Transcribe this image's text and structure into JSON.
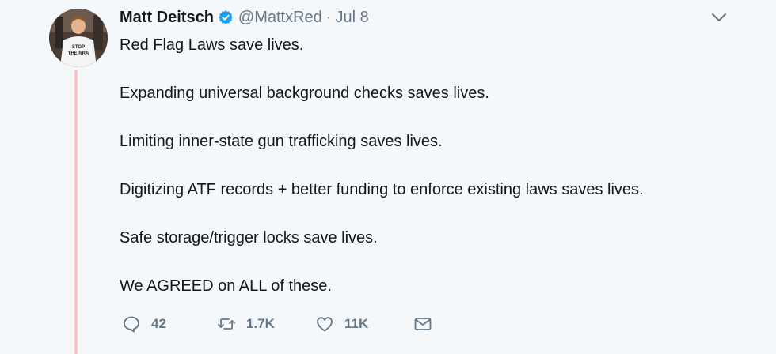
{
  "tweet": {
    "author_name": "Matt Deitsch",
    "handle": "@MattxRed",
    "separator": "·",
    "date": "Jul 8",
    "lines": [
      "Red Flag Laws save lives.",
      "Expanding universal background checks saves lives.",
      "Limiting inner-state gun trafficking saves lives.",
      "Digitizing ATF records + better funding to enforce existing laws saves lives.",
      "Safe storage/trigger locks save lives.",
      "We AGREED on ALL of these."
    ],
    "avatar_shirt_text": "STOP THE NRA",
    "replies": "42",
    "retweets": "1.7K",
    "likes": "11K"
  },
  "icons": {
    "verified": "verified-badge-icon",
    "caret": "chevron-down-icon",
    "reply": "reply-icon",
    "retweet": "retweet-icon",
    "like": "heart-icon",
    "dm": "envelope-icon"
  },
  "colors": {
    "background": "#f5f8fa",
    "text": "#14171a",
    "secondary": "#657786",
    "verified": "#1da1f2",
    "thread_line": "#f6c6c8"
  }
}
